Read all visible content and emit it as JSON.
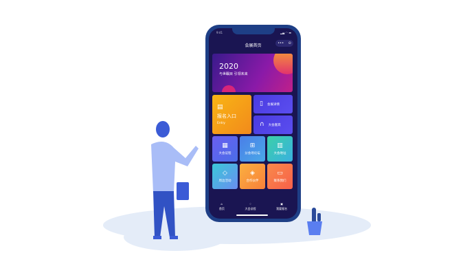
{
  "status": {
    "time": "9:41",
    "icons": "signal-wifi-battery"
  },
  "header": {
    "title": "会展首页",
    "menu": "•••",
    "close": "⊙"
  },
  "banner": {
    "year": "2020",
    "subtitle": "与世瞩目 引领未来"
  },
  "entry": {
    "label": "报名入口",
    "sub": "Entry",
    "icon": "form-icon"
  },
  "side_tiles": [
    {
      "label": "会展详情",
      "icon": "clipboard-icon"
    },
    {
      "label": "大会嘉宾",
      "icon": "headset-icon"
    }
  ],
  "grid": [
    {
      "label": "大会议程",
      "icon": "calendar-icon",
      "color": "#5a5ee8"
    },
    {
      "label": "分会场论坛",
      "icon": "grid-icon",
      "color": "#4a8ee8"
    },
    {
      "label": "大会地址",
      "icon": "building-icon",
      "color": "#3bc7b8"
    },
    {
      "label": "周边活动",
      "icon": "tag-icon",
      "color": "#4ab6d8"
    },
    {
      "label": "合作伙伴",
      "icon": "handshake-icon",
      "color": "#f99a3a"
    },
    {
      "label": "联系我们",
      "icon": "chat-icon",
      "color": "#f86c4a"
    }
  ],
  "tabbar": [
    {
      "label": "首页",
      "icon": "home-icon"
    },
    {
      "label": "大会议程",
      "icon": "drop-icon"
    },
    {
      "label": "我要报名",
      "icon": "form-icon"
    }
  ]
}
